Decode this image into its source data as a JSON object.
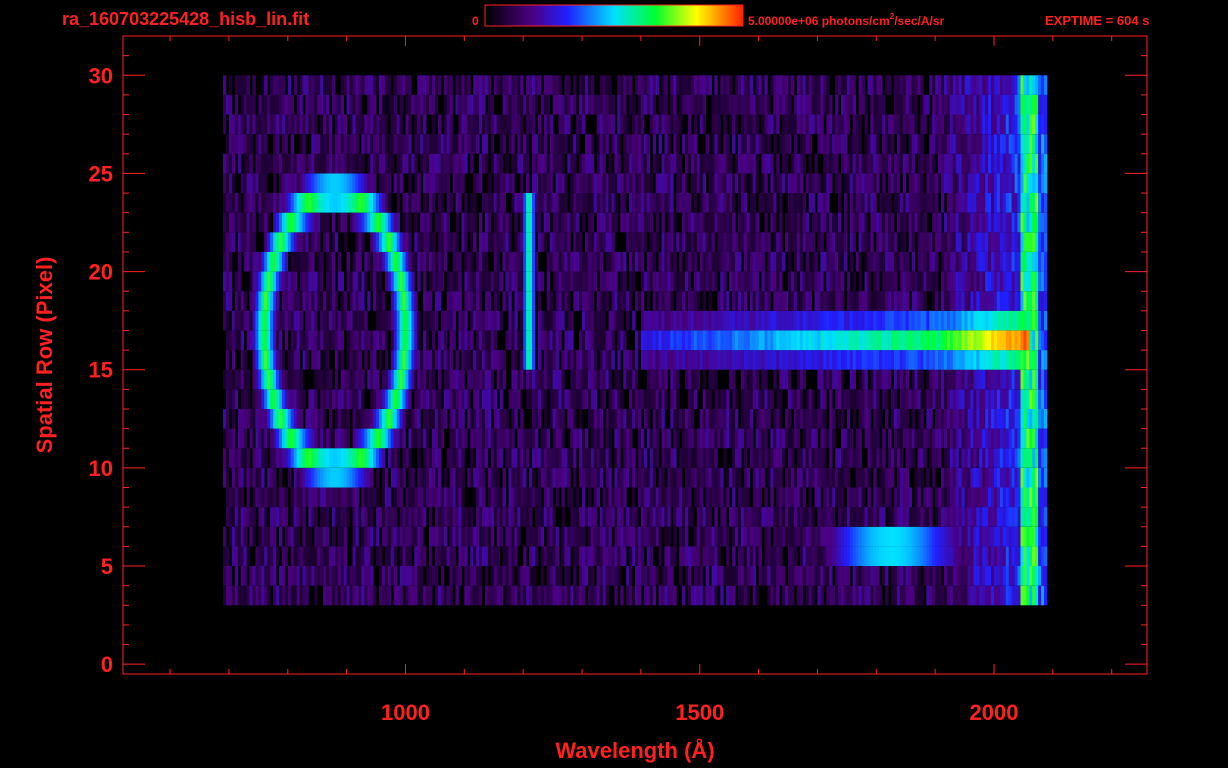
{
  "header": {
    "filename": "ra_160703225428_hisb_lin.fit",
    "colorbar_min": "0",
    "colorbar_max": "5.00000e+06 photons/cm",
    "colorbar_sup": "2",
    "colorbar_unit_rest": "/sec/A/sr",
    "exptime": "EXPTIME = 604 s"
  },
  "colors": {
    "text": "#ff2020",
    "axis": "#ff2020",
    "background": "#000000"
  },
  "chart_data": {
    "type": "heatmap",
    "title": "ra_160703225428_hisb_lin.fit",
    "xlabel": "Wavelength (Å)",
    "ylabel": "Spatial Row (Pixel)",
    "xlim": [
      520,
      2260
    ],
    "ylim": [
      -0.5,
      32
    ],
    "xticks": [
      1000,
      1500,
      2000
    ],
    "yticks": [
      0,
      5,
      10,
      15,
      20,
      25,
      30
    ],
    "colorbar": {
      "min": 0,
      "max": 5000000,
      "unit": "photons/cm2/sec/A/sr",
      "colormap": "rainbow"
    },
    "data_extent": {
      "x": [
        690,
        2090
      ],
      "rows": [
        3,
        30
      ]
    },
    "features": [
      {
        "name": "emission ring (left loop)",
        "center_x": 880,
        "center_y": 17,
        "x_radius": 120,
        "y_radius": 7,
        "peak_level": 0.55
      },
      {
        "name": "bright vertical line",
        "x": 1210,
        "row_min": 15.5,
        "row_max": 24,
        "peak_level": 0.55
      },
      {
        "name": "continuum band",
        "row": 16.5,
        "x_start": 1400,
        "x_end": 2060,
        "level_start": 0.25,
        "level_end": 0.7
      },
      {
        "name": "lower band",
        "row": 6,
        "x_start": 1700,
        "x_end": 1990,
        "peak_level": 0.45
      },
      {
        "name": "red edge column",
        "x": 2060,
        "row_min": 1,
        "row_max": 30,
        "peak_level": 0.75
      }
    ]
  }
}
